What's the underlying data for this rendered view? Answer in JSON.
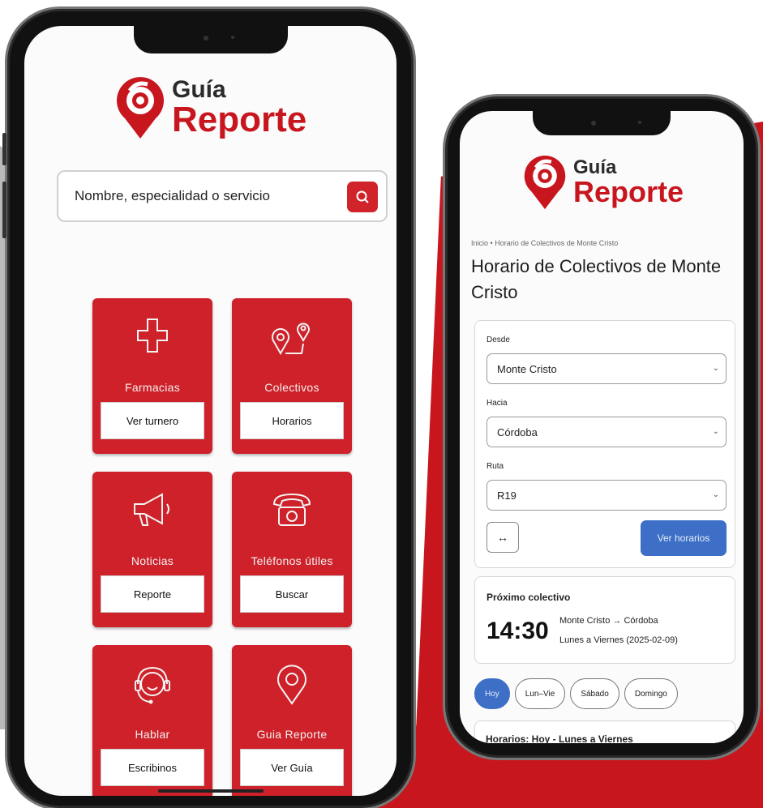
{
  "brand": {
    "word_top": "Guía",
    "word_bottom": "Reporte",
    "red": "#c8161e",
    "blue": "#3c6fc5"
  },
  "left_phone": {
    "search": {
      "placeholder": "Nombre, especialidad o servicio",
      "icon": "search-icon"
    },
    "tiles": [
      {
        "label": "Farmacias",
        "button": "Ver turnero",
        "icon": "medical-cross-icon"
      },
      {
        "label": "Colectivos",
        "button": "Horarios",
        "icon": "map-pins-icon"
      },
      {
        "label": "Noticias",
        "button": "Reporte",
        "icon": "megaphone-icon"
      },
      {
        "label": "Teléfonos útiles",
        "button": "Buscar",
        "icon": "telephone-icon"
      },
      {
        "label": "Hablar",
        "button": "Escribinos",
        "icon": "headset-agent-icon"
      },
      {
        "label": "Guia Reporte",
        "button": "Ver Guía",
        "icon": "location-pin-icon"
      }
    ]
  },
  "right_phone": {
    "breadcrumb": {
      "home": "Inicio",
      "separator": "•",
      "current": "Horario de Colectivos de Monte Cristo"
    },
    "page_title": "Horario de Colectivos de Monte Cristo",
    "form": {
      "from_label": "Desde",
      "from_value": "Monte Cristo",
      "to_label": "Hacia",
      "to_value": "Córdoba",
      "route_label": "Ruta",
      "route_value": "R19",
      "swap_label": "↔",
      "submit_label": "Ver horarios"
    },
    "next_bus": {
      "title": "Próximo colectivo",
      "time": "14:30",
      "route": "Monte Cristo → Córdoba",
      "days": "Lunes a Viernes (2025-02-09)"
    },
    "day_tabs": [
      "Hoy",
      "Lun–Vie",
      "Sábado",
      "Domingo"
    ],
    "active_tab": "Hoy",
    "schedule_heading": {
      "prefix": "Horarios: Hoy - ",
      "day": "Lunes a Viernes"
    }
  }
}
